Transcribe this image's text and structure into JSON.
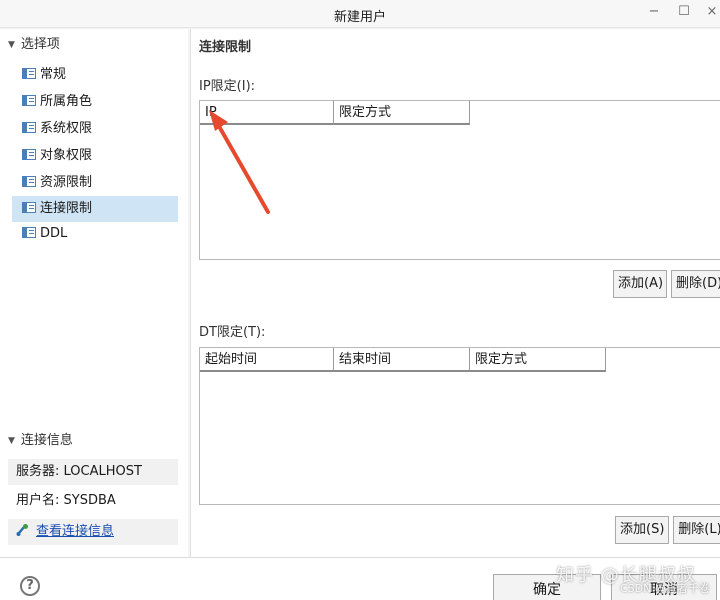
{
  "window": {
    "title": "新建用户",
    "controls": {
      "minimize": "−",
      "maximize": "☐",
      "close": "×"
    }
  },
  "sidebar": {
    "section_label": "选择项",
    "items": [
      {
        "label": "常规",
        "icon": "form-icon"
      },
      {
        "label": "所属角色",
        "icon": "form-icon"
      },
      {
        "label": "系统权限",
        "icon": "form-icon"
      },
      {
        "label": "对象权限",
        "icon": "form-icon"
      },
      {
        "label": "资源限制",
        "icon": "form-icon"
      },
      {
        "label": "连接限制",
        "icon": "form-icon",
        "selected": true
      },
      {
        "label": "DDL",
        "icon": "form-icon"
      }
    ],
    "connection": {
      "section_label": "连接信息",
      "server": "服务器: LOCALHOST",
      "user": "用户名: SYSDBA",
      "view_link": "查看连接信息"
    }
  },
  "main": {
    "page_title": "连接限制",
    "ip_section": {
      "label": "IP限定(I):",
      "columns": [
        "IP",
        "限定方式"
      ],
      "add_button": "添加(A)",
      "delete_button": "删除(D)"
    },
    "dt_section": {
      "label": "DT限定(T):",
      "columns": [
        "起始时间",
        "结束时间",
        "限定方式"
      ],
      "add_button": "添加(S)",
      "delete_button": "删除(L)"
    }
  },
  "footer": {
    "help_glyph": "?",
    "ok_button": "确定",
    "cancel_button": "取消"
  },
  "overlay": {
    "watermark": "知乎 @长腿叔叔",
    "watermark_small": "CSDN @旅者千卷",
    "arrow_color": "#e64a2e"
  },
  "colors": {
    "selection": "#cfe4f5",
    "link": "#1a4fb0",
    "accent_icon": "#4a7fb8"
  }
}
